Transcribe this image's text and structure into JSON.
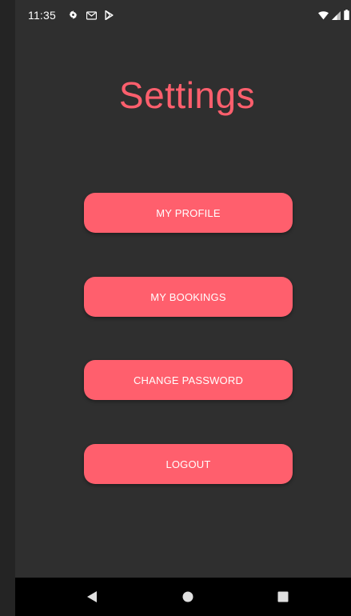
{
  "status_bar": {
    "time": "11:35",
    "left_icons": [
      "settings-icon",
      "gmail-icon",
      "play-store-icon"
    ],
    "right_icons": [
      "wifi-icon",
      "signal-icon",
      "battery-icon"
    ]
  },
  "screen": {
    "title": "Settings",
    "accent_color": "#ff5f6d",
    "background_color": "#2f2f2f"
  },
  "menu": {
    "items": [
      {
        "label": "MY PROFILE"
      },
      {
        "label": "MY BOOKINGS"
      },
      {
        "label": "CHANGE PASSWORD"
      },
      {
        "label": "LOGOUT"
      }
    ]
  },
  "nav_bar": {
    "buttons": [
      "back-icon",
      "home-icon",
      "recents-icon"
    ]
  }
}
